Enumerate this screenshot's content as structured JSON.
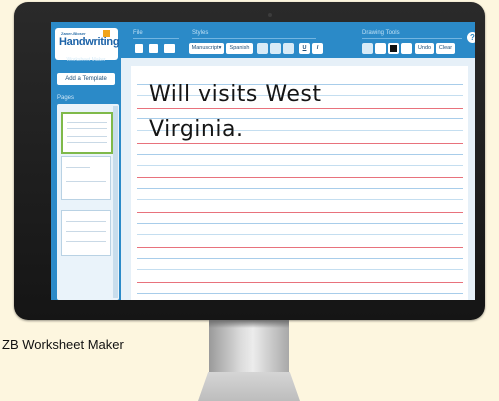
{
  "caption": "ZB Worksheet Maker",
  "app": {
    "logo": {
      "brand": "Zaner-Bloser",
      "title": "Handwriting",
      "subtitle": "Worksheet Maker"
    },
    "toolbar": {
      "file_label": "File",
      "styles_label": "Styles",
      "style_select": "Manuscript",
      "language_button": "Spanish",
      "underline_button": "U",
      "italic_button": "I",
      "drawing_label": "Drawing Tools",
      "undo_button": "Undo",
      "clear_button": "Clear",
      "help_button": "?"
    },
    "sidebar": {
      "add_template": "Add a Template",
      "pages_label": "Pages",
      "thumbnails": 3,
      "active_page": 1
    },
    "worksheet": {
      "lines": [
        "Will visits West",
        "Virginia."
      ]
    }
  },
  "colors": {
    "app_blue": "#2b8ac8",
    "page_background": "#fdf6df",
    "red_line": "#e8727c",
    "blue_line": "#a8cdea",
    "active_thumb": "#7fb94a"
  }
}
